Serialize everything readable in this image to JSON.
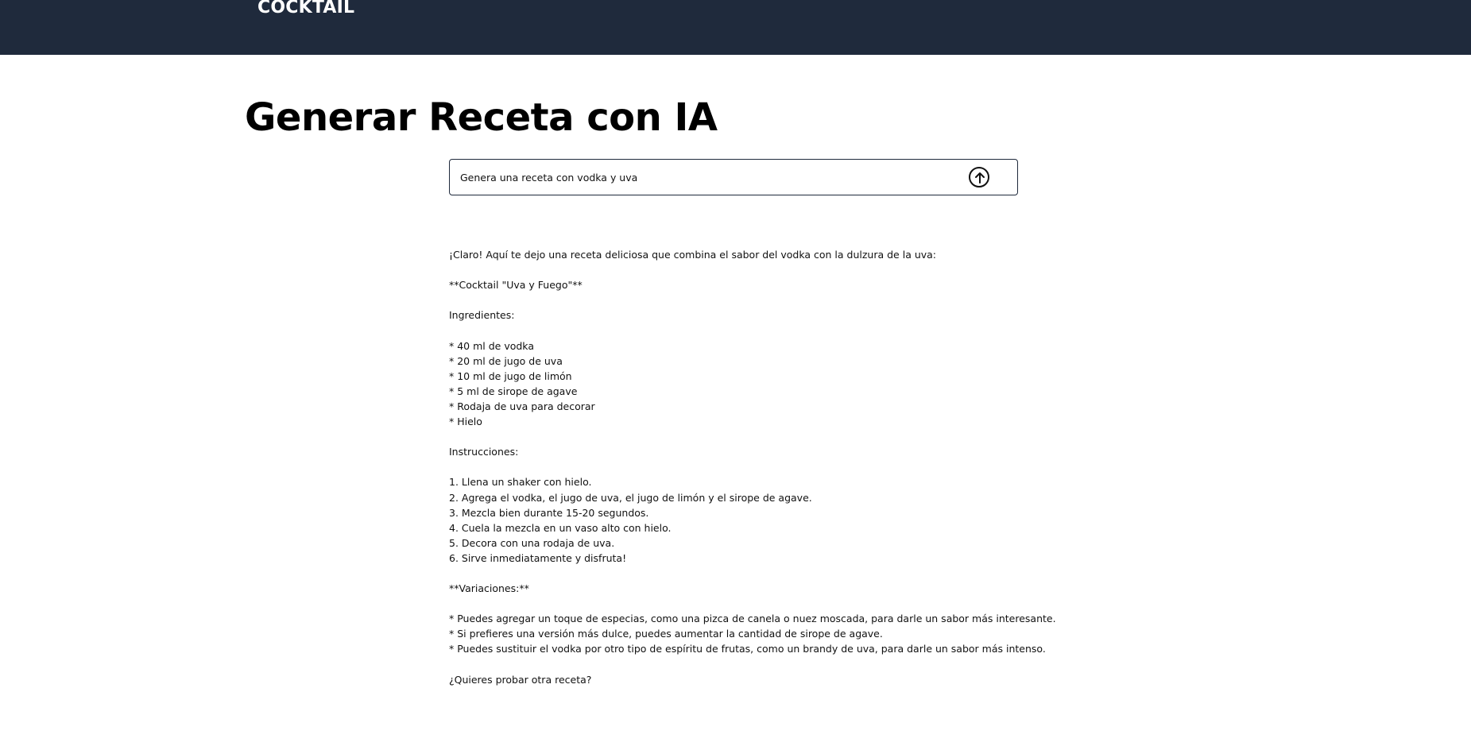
{
  "header": {
    "brand": "COCKTAIL",
    "background": "#1f2a3c"
  },
  "main": {
    "title": "Generar Receta con IA",
    "prompt": {
      "value": "Genera una receta con vodka y uva",
      "send_icon": "arrow-up-circle-icon"
    },
    "response_lines": [
      "¡Claro! Aquí te dejo una receta deliciosa que combina el sabor del vodka con la dulzura de la uva:",
      "",
      "**Cocktail \"Uva y Fuego\"**",
      "",
      "Ingredientes:",
      "",
      "* 40 ml de vodka",
      "* 20 ml de jugo de uva",
      "* 10 ml de jugo de limón",
      "* 5 ml de sirope de agave",
      "* Rodaja de uva para decorar",
      "* Hielo",
      "",
      "Instrucciones:",
      "",
      "1. Llena un shaker con hielo.",
      "2. Agrega el vodka, el jugo de uva, el jugo de limón y el sirope de agave.",
      "3. Mezcla bien durante 15-20 segundos.",
      "4. Cuela la mezcla en un vaso alto con hielo.",
      "5. Decora con una rodaja de uva.",
      "6. Sirve inmediatamente y disfruta!",
      "",
      "**Variaciones:**",
      "",
      "* Puedes agregar un toque de especias, como una pizca de canela o nuez moscada, para darle un sabor más interesante.",
      "* Si prefieres una versión más dulce, puedes aumentar la cantidad de sirope de agave.",
      "* Puedes sustituir el vodka por otro tipo de espíritu de frutas, como un brandy de uva, para darle un sabor más intenso.",
      "",
      "¿Quieres probar otra receta?"
    ]
  }
}
